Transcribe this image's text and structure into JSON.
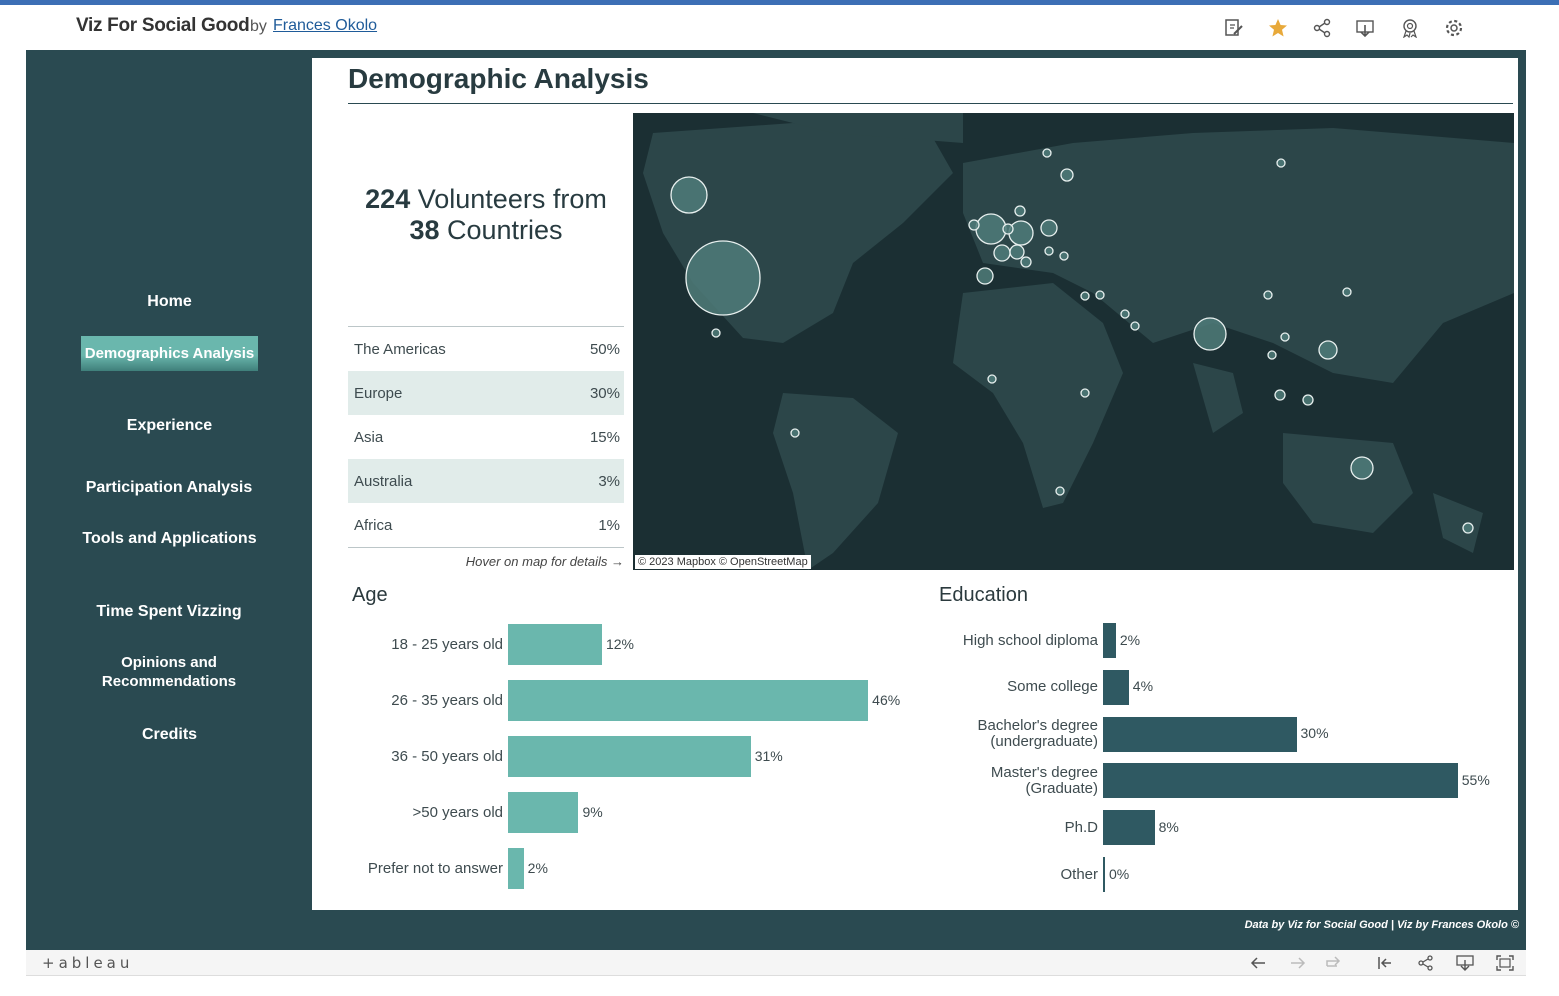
{
  "header": {
    "title": "Viz For Social Good",
    "by": "by",
    "author": "Frances Okolo"
  },
  "toolbar_icons": [
    "edit-icon",
    "star-icon",
    "share-icon",
    "download-icon",
    "badge-icon",
    "settings-icon"
  ],
  "nav": {
    "items": [
      {
        "label": "Home"
      },
      {
        "label": "Demographics Analysis",
        "active": true
      },
      {
        "label": "Experience"
      },
      {
        "label": "Participation Analysis"
      },
      {
        "label": "Tools and Applications"
      },
      {
        "label": "Time Spent Vizzing"
      },
      {
        "label": "Opinions and Recommendations"
      },
      {
        "label": "Credits"
      }
    ]
  },
  "main": {
    "title": "Demographic Analysis",
    "summary": {
      "volunteers": "224",
      "volunteers_text": "Volunteers from",
      "countries": "38",
      "countries_text": "Countries"
    },
    "regions": [
      {
        "name": "The Americas",
        "pct": "50%"
      },
      {
        "name": "Europe",
        "pct": "30%"
      },
      {
        "name": "Asia",
        "pct": "15%"
      },
      {
        "name": "Australia",
        "pct": "3%"
      },
      {
        "name": "Africa",
        "pct": "1%"
      }
    ],
    "hover_note": "Hover on map for details →",
    "map_attribution": "© 2023 Mapbox  © OpenStreetMap"
  },
  "chart_data": [
    {
      "type": "bar",
      "orientation": "horizontal",
      "title": "Age",
      "categories": [
        "18 - 25 years old",
        "26 - 35 years old",
        "36 - 50 years old",
        ">50 years old",
        "Prefer not to answer"
      ],
      "values": [
        12,
        46,
        31,
        9,
        2
      ],
      "value_labels": [
        "12%",
        "46%",
        "31%",
        "9%",
        "2%"
      ],
      "color": "#6ab7ad"
    },
    {
      "type": "bar",
      "orientation": "horizontal",
      "title": "Education",
      "categories": [
        "High school diploma",
        "Some college",
        "Bachelor's degree (undergraduate)",
        "Master's degree (Graduate)",
        "Ph.D",
        "Other"
      ],
      "values": [
        2,
        4,
        30,
        55,
        8,
        0
      ],
      "value_labels": [
        "2%",
        "4%",
        "30%",
        "55%",
        "8%",
        "0%"
      ],
      "color": "#2f5962"
    }
  ],
  "footer": {
    "credit": "Data by Viz for Social Good  |  Viz by Frances Okolo ©"
  },
  "bottombar": {
    "logo": "+ableau",
    "icons": [
      "undo-icon",
      "redo-icon",
      "revert-icon",
      "reset-icon",
      "share-icon",
      "download-icon",
      "fullscreen-icon"
    ]
  },
  "colors": {
    "sidebar": "#2a4a51",
    "accent": "#6ab7ad",
    "education_bar": "#2f5962",
    "map_bg": "#1b2f33",
    "star": "#e8a93a"
  }
}
